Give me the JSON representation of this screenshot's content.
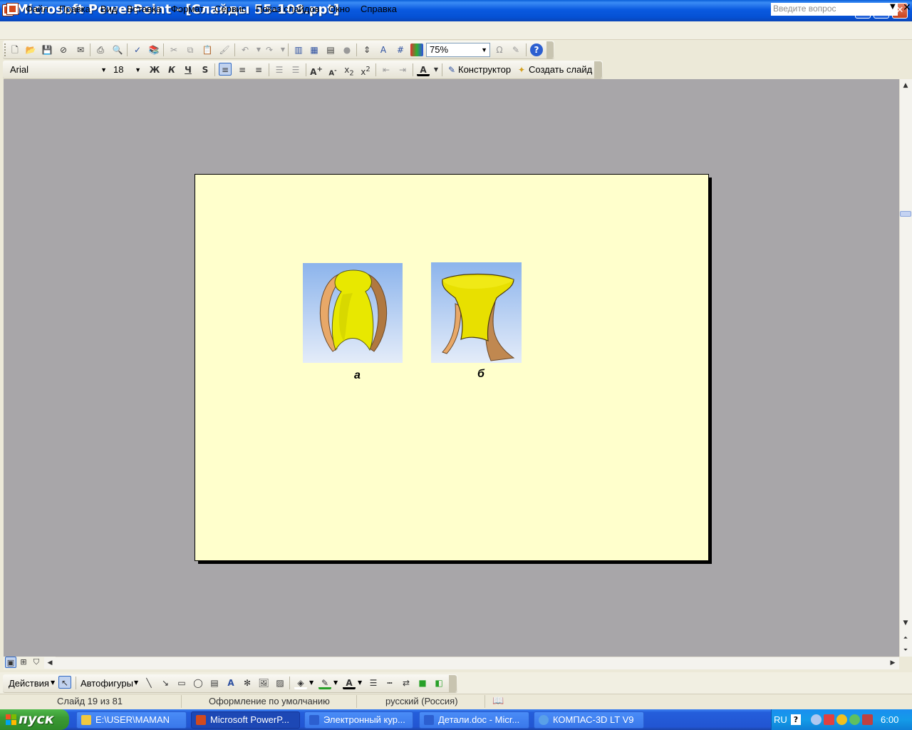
{
  "window": {
    "title": "Microsoft PowerPoint - [Слайды 55-108.ppt]",
    "controls": [
      "minimize",
      "restore",
      "close"
    ]
  },
  "menubar": {
    "items": [
      "Файл",
      "Правка",
      "Вид",
      "Вставка",
      "Формат",
      "Сервис",
      "Показ слайдов",
      "Окно",
      "Справка"
    ],
    "help_placeholder": "Введите вопрос"
  },
  "toolbar_standard": {
    "zoom": "75%"
  },
  "toolbar_formatting": {
    "font_name": "Arial",
    "font_size": "18",
    "bold_label": "Ж",
    "italic_label": "К",
    "underline_label": "Ч",
    "shadow_label": "S",
    "designer_label": "Конструктор",
    "new_slide_label": "Создать слайд"
  },
  "slide": {
    "background": "#ffffcc",
    "captions": {
      "a": "а",
      "b": "б"
    }
  },
  "drawing_toolbar": {
    "actions_label": "Действия",
    "autoshapes_label": "Автофигуры"
  },
  "statusbar": {
    "slide_position": "Слайд 19 из 81",
    "design": "Оформление по умолчанию",
    "language": "русский (Россия)"
  },
  "taskbar": {
    "start_label": "пуск",
    "tasks": [
      {
        "label": "E:\\USER\\MAMAN",
        "icon": "folder-icon"
      },
      {
        "label": "Microsoft PowerP...",
        "icon": "powerpoint-icon",
        "active": true
      },
      {
        "label": "Электронный кур...",
        "icon": "word-icon"
      },
      {
        "label": "Детали.doc - Micr...",
        "icon": "word-icon"
      },
      {
        "label": "КОМПАС-3D LT V9",
        "icon": "kompas-icon"
      }
    ],
    "language_indicator": "RU",
    "clock": "6:00"
  }
}
